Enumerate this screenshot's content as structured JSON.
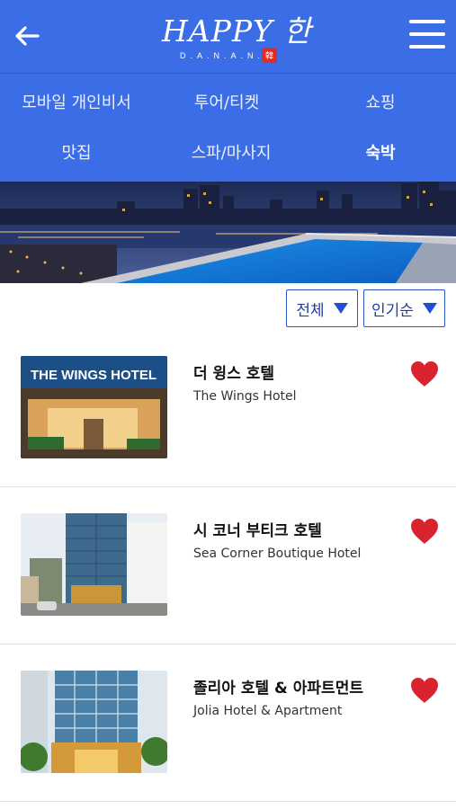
{
  "header": {
    "logo_main": "HAPPY 한",
    "logo_sub": "D.A.N.A.N.G",
    "logo_seal": "韓"
  },
  "categories": [
    {
      "label": "모바일 개인비서",
      "active": false
    },
    {
      "label": "투어/티켓",
      "active": false
    },
    {
      "label": "쇼핑",
      "active": false
    },
    {
      "label": "맛집",
      "active": false
    },
    {
      "label": "스파/마사지",
      "active": false
    },
    {
      "label": "숙박",
      "active": true
    }
  ],
  "filters": {
    "region": "전체",
    "sort": "인기순"
  },
  "hotels": [
    {
      "name_ko": "더 윙스 호텔",
      "name_en": "The Wings Hotel",
      "sign": "THE WINGS HOTEL",
      "favorited": true
    },
    {
      "name_ko": "시 코너 부티크 호텔",
      "name_en": "Sea Corner Boutique Hotel",
      "favorited": true
    },
    {
      "name_ko": "졸리아 호텔 & 아파트먼트",
      "name_en": "Jolia Hotel & Apartment",
      "favorited": true
    }
  ],
  "colors": {
    "brand_blue": "#3b6ee6",
    "heart_red": "#d9232e"
  }
}
